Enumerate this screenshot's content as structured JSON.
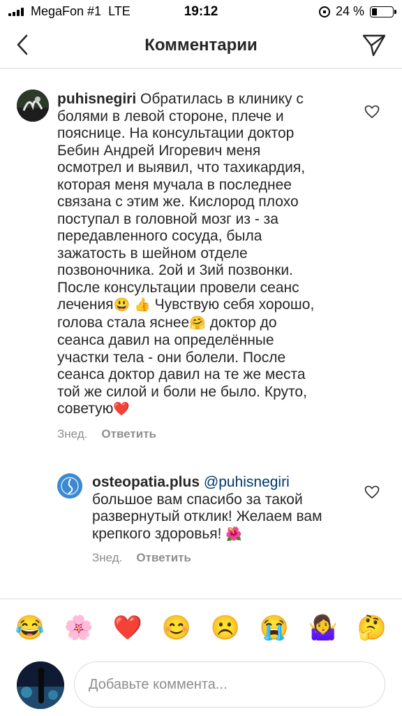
{
  "status_bar": {
    "carrier": "MegaFon #1",
    "network": "LTE",
    "time": "19:12",
    "battery_percent": "24 %",
    "battery_level": 0.24
  },
  "nav": {
    "title": "Комментарии"
  },
  "comments": [
    {
      "username": "puhisnegiri",
      "text_lines": [
        "Обратилась в клинику с",
        "болями в левой стороне, плече и",
        "пояснице. На консультации доктор",
        "Бебин Андрей Игоревич меня",
        "осмотрел и выявил, что тахикардия,",
        "которая меня мучала в последнее",
        "связана с этим же. Кислород плохо",
        "поступал в головной мозг из - за",
        "передавленного сосуда, была",
        "зажатость в шейном отделе",
        "позвоночника. 2ой и 3ий позвонки.",
        "После консультации провели сеанс",
        "лечения",
        "Чувствую себя хорошо,",
        "голова стала яснее",
        "доктор до",
        "сеанса давил на определённые",
        "участки тела - они болели. После",
        "сеанса доктор давил на те же места",
        "той же силой и боли не было. Круто,",
        "советую"
      ],
      "emojis": {
        "smile": "😃",
        "thumbs": "👍",
        "hug": "🤗",
        "heart": "❤️"
      },
      "time": "Знед.",
      "reply_label": "Ответить"
    },
    {
      "username": "osteopatia.plus",
      "mention": "@puhisnegiri",
      "text_lines": [
        "большое вам спасибо за такой",
        "развернутый отклик! Желаем вам",
        "крепкого здоровья!"
      ],
      "emoji": "🌺",
      "time": "Знед.",
      "reply_label": "Ответить"
    }
  ],
  "emoji_bar": [
    "😂",
    "🌸",
    "❤️",
    "😊",
    "☹️",
    "😭",
    "🤷‍♀️",
    "🤔"
  ],
  "composer": {
    "placeholder": "Добавьте коммента..."
  },
  "colors": {
    "text": "#262626",
    "secondary": "#8e8e8e",
    "mention": "#00376b",
    "divider": "#dbdbdb"
  }
}
